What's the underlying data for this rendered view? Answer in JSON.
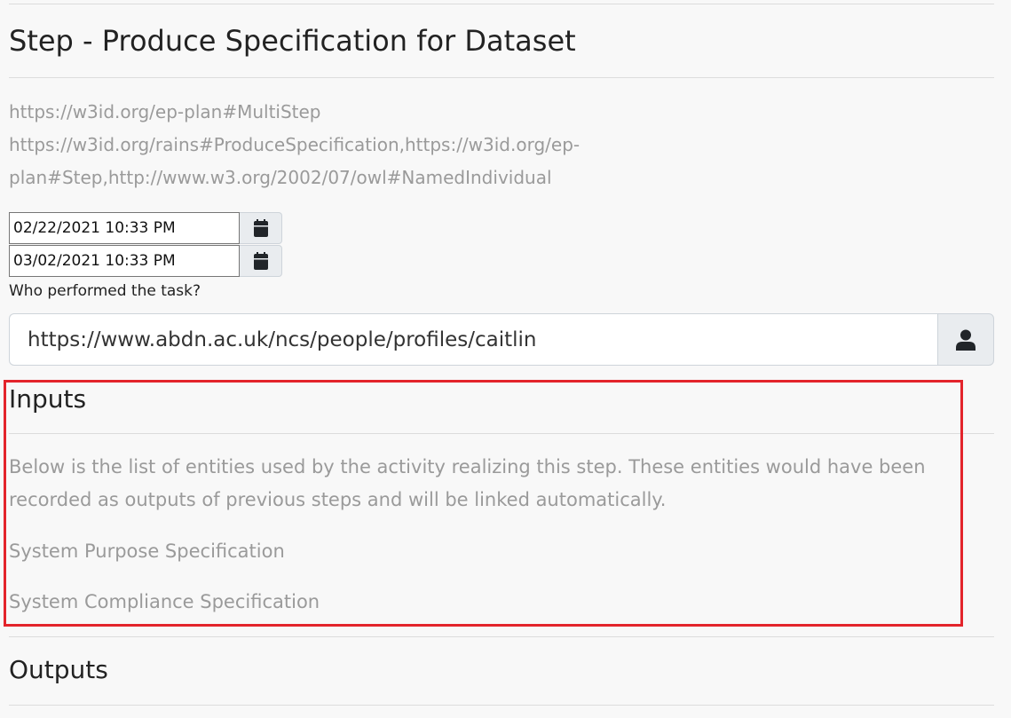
{
  "step": {
    "title": "Step - Produce Specification for Dataset",
    "types": [
      "https://w3id.org/ep-plan#MultiStep",
      "https://w3id.org/rains#ProduceSpecification,https://w3id.org/ep-",
      "plan#Step,http://www.w3.org/2002/07/owl#NamedIndividual"
    ]
  },
  "dates": {
    "start": "02/22/2021 10:33 PM",
    "end": "03/02/2021 10:33 PM",
    "button_icon": "calendar-icon"
  },
  "agent": {
    "label": "Who performed the task?",
    "value": "https://www.abdn.ac.uk/ncs/people/profiles/caitlin",
    "button_icon": "user-icon"
  },
  "inputs": {
    "heading": "Inputs",
    "description": "Below is the list of entities used by the activity realizing this step. These entities would have been recorded as outputs of previous steps and will be linked automatically.",
    "items": [
      "System Purpose Specification",
      "System Compliance Specification"
    ]
  },
  "outputs": {
    "heading": "Outputs"
  },
  "colors": {
    "highlight": "#e3242b",
    "muted_text": "#9a9a9a",
    "background": "#f8f8f8"
  }
}
